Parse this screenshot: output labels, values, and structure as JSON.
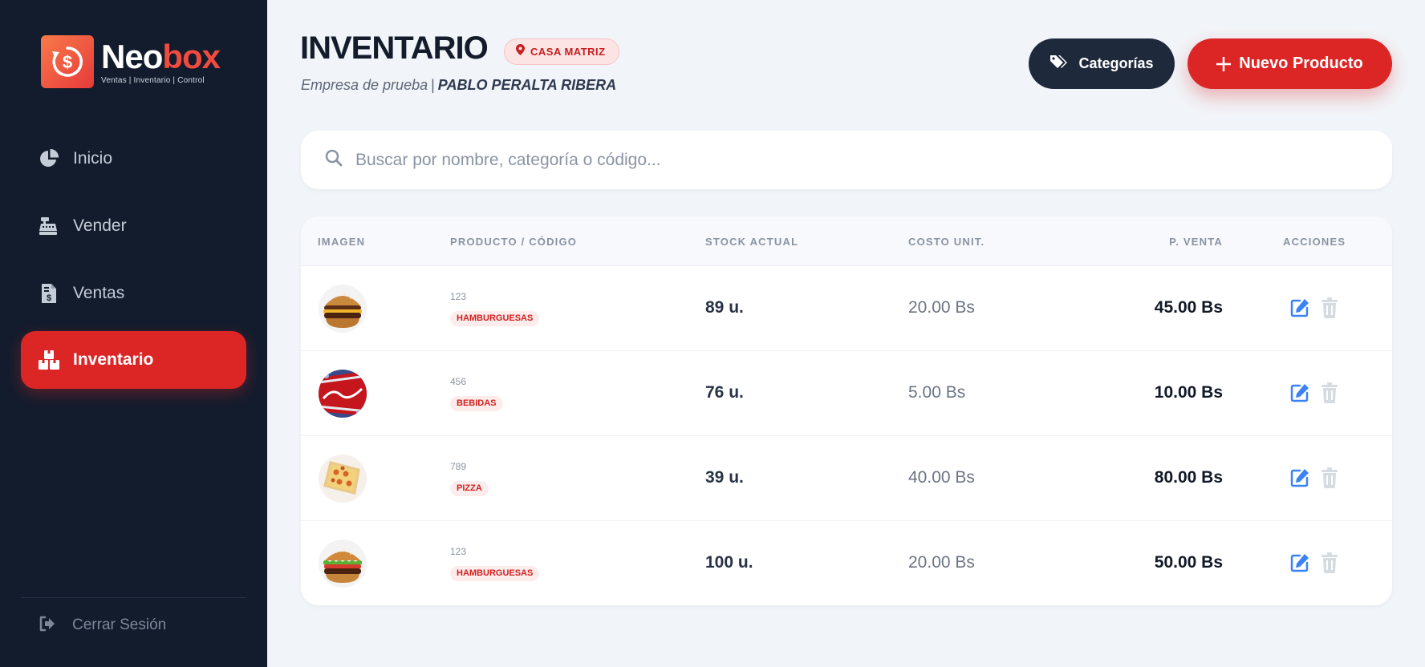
{
  "brand": {
    "name_part1": "Neo",
    "name_part2": "box",
    "tagline": "Ventas | Inventario | Control",
    "logo_icon": "dollar-refresh-icon"
  },
  "sidebar": {
    "items": [
      {
        "label": "Inicio",
        "icon": "pie-chart-icon",
        "active": false
      },
      {
        "label": "Vender",
        "icon": "cash-register-icon",
        "active": false
      },
      {
        "label": "Ventas",
        "icon": "invoice-dollar-icon",
        "active": false
      },
      {
        "label": "Inventario",
        "icon": "boxes-icon",
        "active": true
      }
    ],
    "logout_label": "Cerrar Sesión"
  },
  "header": {
    "title": "INVENTARIO",
    "branch": "CASA MATRIZ",
    "company": "Empresa de prueba",
    "separator": "|",
    "user": "PABLO PERALTA RIBERA",
    "categories_button": "Categorías",
    "new_product_button": "Nuevo Producto"
  },
  "search": {
    "placeholder": "Buscar por nombre, categoría o código...",
    "value": ""
  },
  "table": {
    "columns": {
      "image": "IMAGEN",
      "product": "PRODUCTO / CÓDIGO",
      "stock": "STOCK ACTUAL",
      "cost": "COSTO UNIT.",
      "price": "P. VENTA",
      "actions": "ACCIONES"
    },
    "rows": [
      {
        "code": "123",
        "category": "HAMBURGUESAS",
        "stock": "89 u.",
        "cost": "20.00 Bs",
        "price": "45.00 Bs",
        "image": "burger"
      },
      {
        "code": "456",
        "category": "BEBIDAS",
        "stock": "76 u.",
        "cost": "5.00 Bs",
        "price": "10.00 Bs",
        "image": "cola"
      },
      {
        "code": "789",
        "category": "PIZZA",
        "stock": "39 u.",
        "cost": "40.00 Bs",
        "price": "80.00 Bs",
        "image": "pizza"
      },
      {
        "code": "123",
        "category": "HAMBURGUESAS",
        "stock": "100 u.",
        "cost": "20.00 Bs",
        "price": "50.00 Bs",
        "image": "burger-lettuce"
      }
    ]
  },
  "colors": {
    "sidebar_bg": "#131c2d",
    "accent_red": "#dc2626",
    "dark_button": "#1e293b",
    "page_bg": "#f1f4f8",
    "edit_blue": "#3b82f6"
  }
}
